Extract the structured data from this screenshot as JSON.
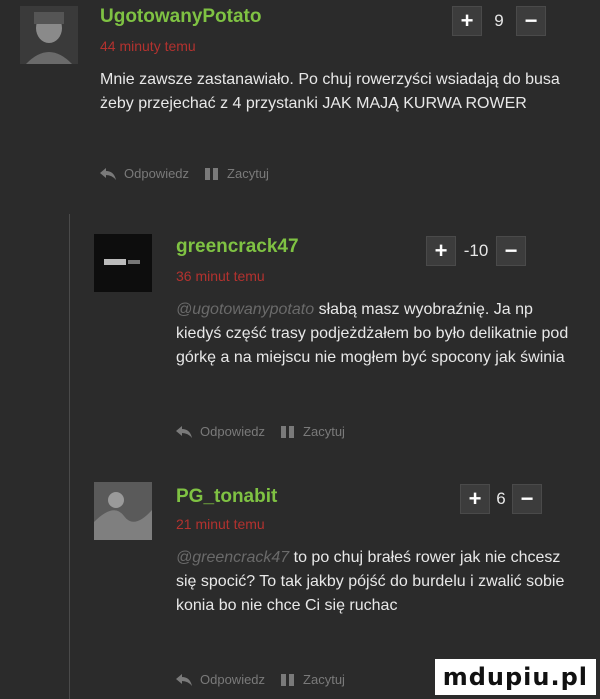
{
  "comments": [
    {
      "username": "UgotowanyPotato",
      "time": "44 minuty temu",
      "score": "9",
      "mention": "",
      "text": "Mnie zawsze zastanawiało. Po chuj rowerzyści wsiadają do busa żeby przejechać z 4 przystanki JAK MAJĄ KURWA ROWER"
    },
    {
      "username": "greencrack47",
      "time": "36 minut temu",
      "score": "-10",
      "mention": "@ugotowanypotato",
      "text": " słabą masz wyobraźnię. Ja np kiedyś część trasy podjeżdżałem bo było delikatnie pod górkę a na miejscu nie mogłem być spocony jak świnia"
    },
    {
      "username": "PG_tonabit",
      "time": "21 minut temu",
      "score": "6",
      "mention": "@greencrack47",
      "text": " to po chuj brałeś rower jak nie chcesz się spocić? To tak jakby pójść do burdelu i zwalić sobie konia bo nie chce Ci się ruchac"
    }
  ],
  "actions": {
    "reply": "Odpowiedz",
    "quote": "Zacytuj"
  },
  "vote": {
    "plus": "+",
    "minus": "−"
  },
  "watermark": "mdupiu.pl",
  "colors": {
    "username": "#7fc243",
    "time": "#b3322f",
    "background": "#2b2b2b"
  }
}
